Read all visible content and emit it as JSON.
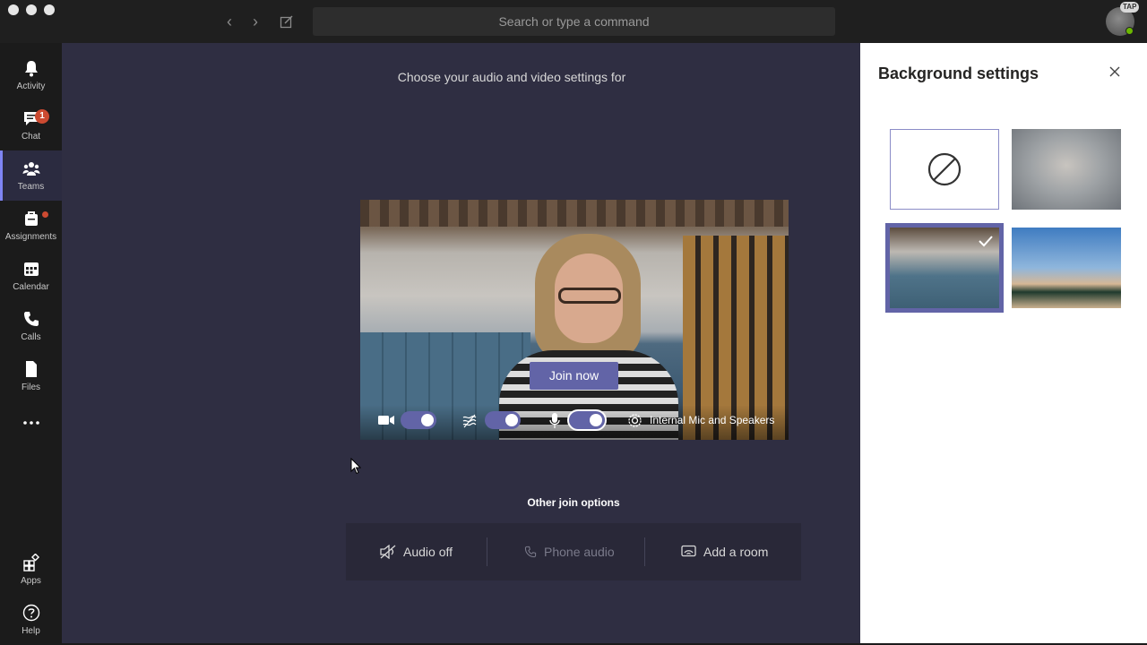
{
  "window": {
    "search_placeholder": "Search or type a command",
    "avatar_badge": "TAP"
  },
  "rail": {
    "items": [
      {
        "label": "Activity",
        "icon": "bell-icon"
      },
      {
        "label": "Chat",
        "icon": "chat-icon",
        "badge": "1"
      },
      {
        "label": "Teams",
        "icon": "teams-icon",
        "active": true
      },
      {
        "label": "Assignments",
        "icon": "assignments-icon",
        "dot": true
      },
      {
        "label": "Calendar",
        "icon": "calendar-icon"
      },
      {
        "label": "Calls",
        "icon": "phone-icon"
      },
      {
        "label": "Files",
        "icon": "file-icon"
      },
      {
        "label": "Apps",
        "icon": "apps-icon"
      },
      {
        "label": "Help",
        "icon": "help-icon"
      }
    ]
  },
  "prejoin": {
    "prompt": "Choose your audio and video settings for",
    "join_label": "Join now",
    "device_label": "Internal Mic and Speakers",
    "toggles": {
      "camera": true,
      "background_blur": true,
      "microphone": true
    },
    "other_title": "Other join options",
    "options": [
      {
        "label": "Audio off",
        "icon": "speaker-off-icon"
      },
      {
        "label": "Phone audio",
        "icon": "phone-icon",
        "disabled": true
      },
      {
        "label": "Add a room",
        "icon": "cast-icon"
      }
    ]
  },
  "background_panel": {
    "title": "Background settings",
    "selected": "office",
    "options": [
      "none",
      "blur",
      "office",
      "beach"
    ]
  },
  "colors": {
    "accent": "#6264a7",
    "badge": "#cc4a31",
    "rail_bg": "#1b1b1b",
    "main_bg": "#2f2e42"
  }
}
